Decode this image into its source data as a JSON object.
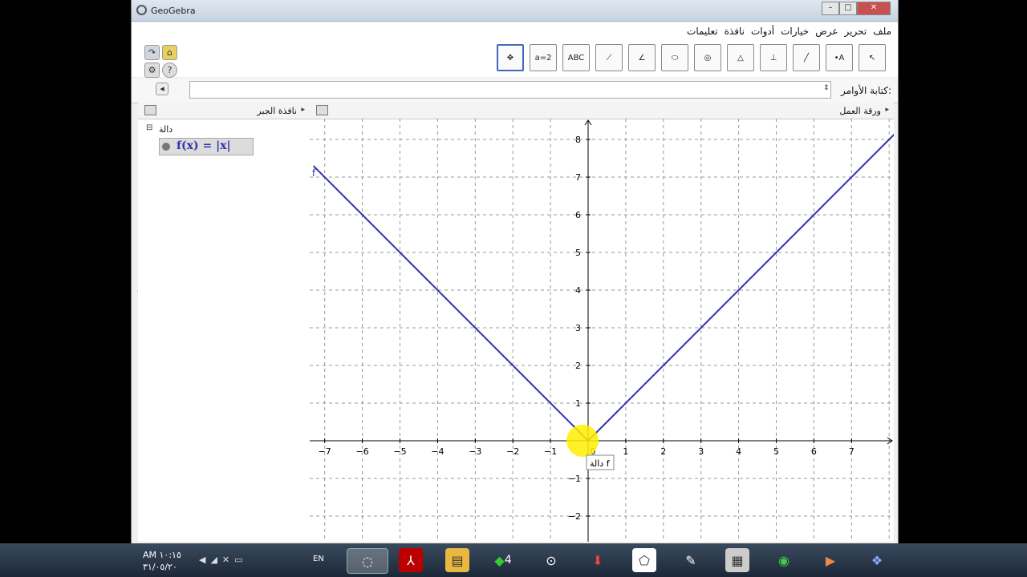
{
  "window": {
    "title": "GeoGebra",
    "controls": [
      "–",
      "□",
      "✕"
    ]
  },
  "menu": {
    "items": [
      "ملف",
      "تحرير",
      "عرض",
      "خيارات",
      "أدوات",
      "نافذة",
      "تعليمات"
    ]
  },
  "toolbar": {
    "tools": [
      {
        "name": "move-graphics-view-tool",
        "label": "✥"
      },
      {
        "name": "slider-tool",
        "label": "a=2"
      },
      {
        "name": "text-tool",
        "label": "ABC"
      },
      {
        "name": "reflect-tool",
        "label": "⟋"
      },
      {
        "name": "angle-tool",
        "label": "∠"
      },
      {
        "name": "conic-tool",
        "label": "⬭"
      },
      {
        "name": "circle-tool",
        "label": "◎"
      },
      {
        "name": "polygon-tool",
        "label": "△"
      },
      {
        "name": "perpendicular-line-tool",
        "label": "⊥"
      },
      {
        "name": "line-tool",
        "label": "╱"
      },
      {
        "name": "point-tool",
        "label": "•A"
      },
      {
        "name": "move-tool",
        "label": "↖"
      }
    ]
  },
  "input_bar": {
    "label": "كتابة الأوامر:",
    "value": ""
  },
  "algebra_view": {
    "title": "نافذة الجبر",
    "folder": "دالة",
    "entries": [
      {
        "text": "f(x) = |x|"
      }
    ]
  },
  "graphics_view": {
    "title": "ورقة العمل",
    "function_label": "f",
    "tooltip": "دالة f",
    "curve_color": "#3333aa"
  },
  "chart_data": {
    "type": "line",
    "title": "",
    "xlabel": "",
    "ylabel": "",
    "xlim": [
      -7.3,
      8.2
    ],
    "ylim": [
      -2.6,
      8.4
    ],
    "xticks": [
      -7,
      -6,
      -5,
      -4,
      -3,
      -2,
      -1,
      0,
      1,
      2,
      3,
      4,
      5,
      6,
      7
    ],
    "yticks": [
      -2,
      -1,
      1,
      2,
      3,
      4,
      5,
      6,
      7,
      8
    ],
    "grid": true,
    "series": [
      {
        "name": "f",
        "x": [
          -7.3,
          0,
          8.2
        ],
        "y": [
          7.3,
          0,
          8.2
        ]
      }
    ]
  },
  "taskbar": {
    "clock_time": "AM ١٠:١٥",
    "clock_date": "٣١/٠٥/٢٠",
    "language": "EN",
    "badge": "4"
  }
}
